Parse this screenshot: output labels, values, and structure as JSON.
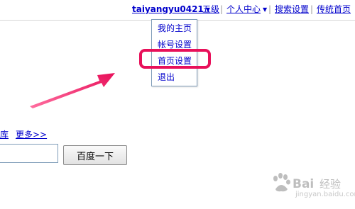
{
  "topbar": {
    "username": "taiyangyu0421",
    "level": "五级",
    "personal_center": "个人中心",
    "search_settings": "搜索设置",
    "classic_home": "传统首页",
    "separator": "|"
  },
  "dropdown": {
    "items": [
      {
        "label": "我的主页"
      },
      {
        "label": "帐号设置"
      },
      {
        "label": "首页设置"
      },
      {
        "label": "退出"
      }
    ]
  },
  "links": {
    "ku": "库",
    "more": "更多>>"
  },
  "search": {
    "value": "",
    "button_label": "百度一下"
  },
  "watermark": {
    "text": "jingyan.baidu.com"
  },
  "colors": {
    "link": "#0000cc",
    "highlight": "#e8105a",
    "arrow": "#f0206a"
  }
}
